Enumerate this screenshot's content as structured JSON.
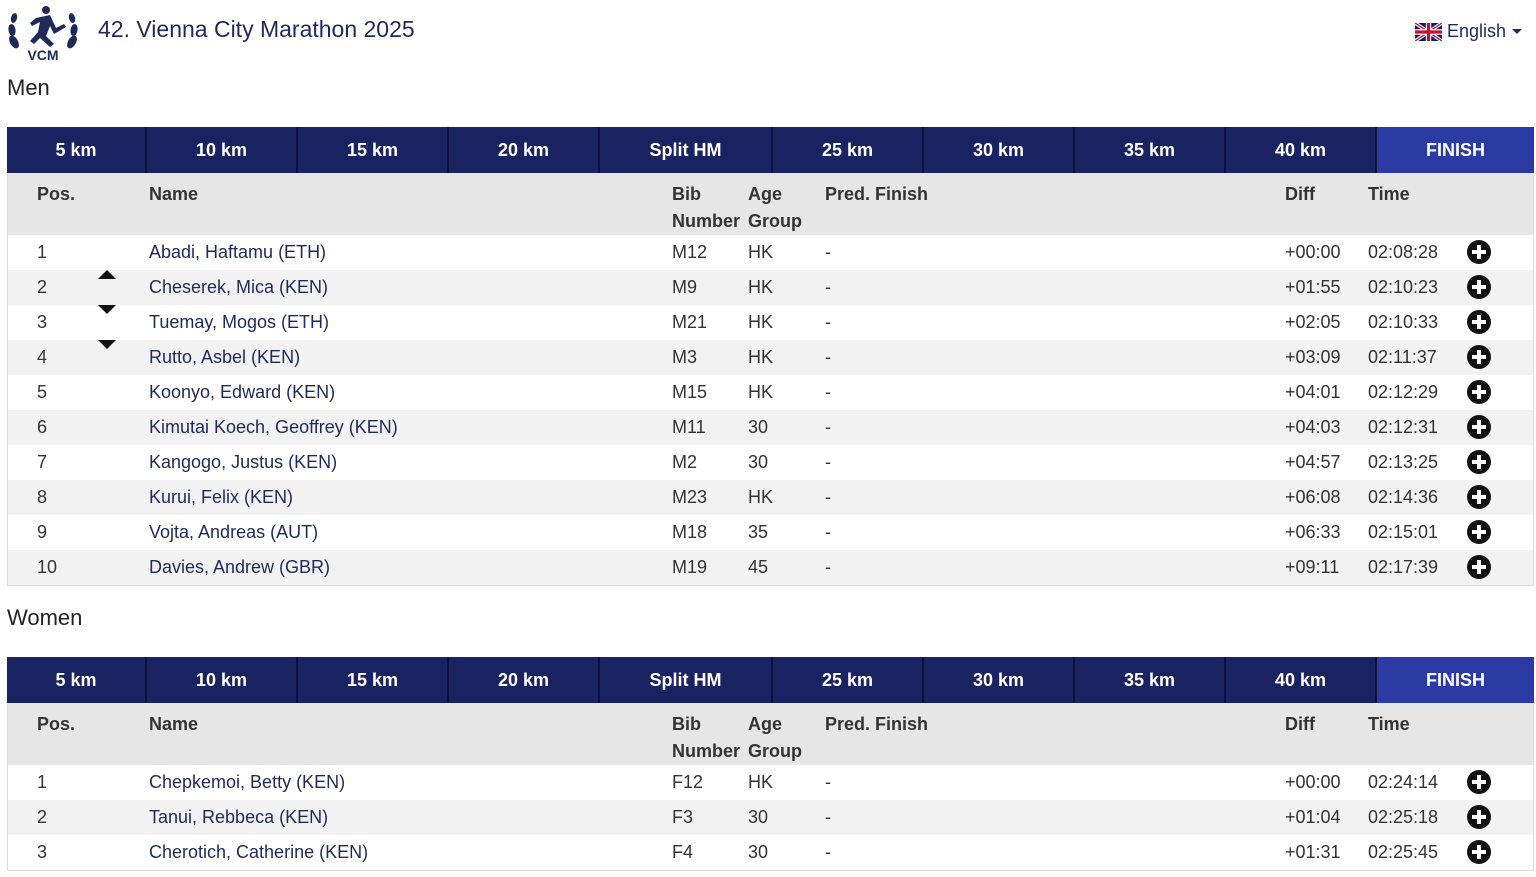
{
  "header": {
    "title": "42. Vienna City Marathon 2025",
    "logo_text": "VCM",
    "language": "English"
  },
  "tabs": [
    "5 km",
    "10 km",
    "15 km",
    "20 km",
    "Split HM",
    "25 km",
    "30 km",
    "35 km",
    "40 km",
    "FINISH"
  ],
  "active_tab": "FINISH",
  "columns": {
    "pos": "Pos.",
    "name": "Name",
    "bib": "Bib",
    "bib2": "Number",
    "age": "Age",
    "age2": "Group",
    "pred": "Pred. Finish",
    "diff": "Diff",
    "time": "Time"
  },
  "men": {
    "title": "Men",
    "rows": [
      {
        "pos": "1",
        "trend": "",
        "name": "Abadi, Haftamu (ETH)",
        "bib": "M12",
        "age": "HK",
        "pred": "-",
        "diff": "+00:00",
        "time": "02:08:28"
      },
      {
        "pos": "2",
        "trend": "up",
        "name": "Cheserek, Mica (KEN)",
        "bib": "M9",
        "age": "HK",
        "pred": "-",
        "diff": "+01:55",
        "time": "02:10:23"
      },
      {
        "pos": "3",
        "trend": "down",
        "name": "Tuemay, Mogos (ETH)",
        "bib": "M21",
        "age": "HK",
        "pred": "-",
        "diff": "+02:05",
        "time": "02:10:33"
      },
      {
        "pos": "4",
        "trend": "down",
        "name": "Rutto, Asbel (KEN)",
        "bib": "M3",
        "age": "HK",
        "pred": "-",
        "diff": "+03:09",
        "time": "02:11:37"
      },
      {
        "pos": "5",
        "trend": "",
        "name": "Koonyo, Edward (KEN)",
        "bib": "M15",
        "age": "HK",
        "pred": "-",
        "diff": "+04:01",
        "time": "02:12:29"
      },
      {
        "pos": "6",
        "trend": "",
        "name": "Kimutai Koech, Geoffrey (KEN)",
        "bib": "M11",
        "age": "30",
        "pred": "-",
        "diff": "+04:03",
        "time": "02:12:31"
      },
      {
        "pos": "7",
        "trend": "",
        "name": "Kangogo, Justus (KEN)",
        "bib": "M2",
        "age": "30",
        "pred": "-",
        "diff": "+04:57",
        "time": "02:13:25"
      },
      {
        "pos": "8",
        "trend": "",
        "name": "Kurui, Felix (KEN)",
        "bib": "M23",
        "age": "HK",
        "pred": "-",
        "diff": "+06:08",
        "time": "02:14:36"
      },
      {
        "pos": "9",
        "trend": "",
        "name": "Vojta, Andreas (AUT)",
        "bib": "M18",
        "age": "35",
        "pred": "-",
        "diff": "+06:33",
        "time": "02:15:01"
      },
      {
        "pos": "10",
        "trend": "",
        "name": "Davies, Andrew (GBR)",
        "bib": "M19",
        "age": "45",
        "pred": "-",
        "diff": "+09:11",
        "time": "02:17:39"
      }
    ]
  },
  "women": {
    "title": "Women",
    "rows": [
      {
        "pos": "1",
        "trend": "",
        "name": "Chepkemoi, Betty (KEN)",
        "bib": "F12",
        "age": "HK",
        "pred": "-",
        "diff": "+00:00",
        "time": "02:24:14"
      },
      {
        "pos": "2",
        "trend": "",
        "name": "Tanui, Rebbeca (KEN)",
        "bib": "F3",
        "age": "30",
        "pred": "-",
        "diff": "+01:04",
        "time": "02:25:18"
      },
      {
        "pos": "3",
        "trend": "",
        "name": "Cherotich, Catherine (KEN)",
        "bib": "F4",
        "age": "30",
        "pred": "-",
        "diff": "+01:31",
        "time": "02:25:45"
      }
    ]
  },
  "colors": {
    "nav_bg": "#1a2362",
    "nav_active": "#2b3aa4",
    "link": "#1f2a5a"
  }
}
